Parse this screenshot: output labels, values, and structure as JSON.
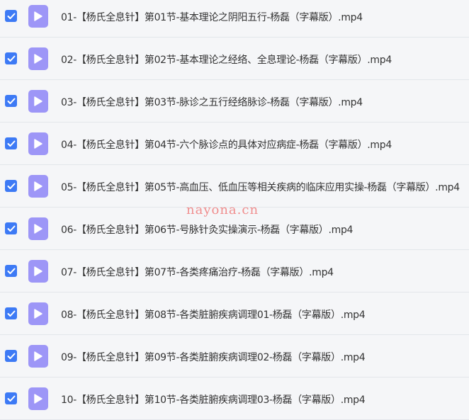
{
  "files": [
    {
      "name": "01-【杨氏全息针】第01节-基本理论之阴阳五行-杨磊（字幕版）.mp4",
      "checked": true,
      "icon": "video-file-icon"
    },
    {
      "name": "02-【杨氏全息针】第02节-基本理论之经络、全息理论-杨磊（字幕版）.mp4",
      "checked": true,
      "icon": "video-file-icon"
    },
    {
      "name": "03-【杨氏全息针】第03节-脉诊之五行经络脉诊-杨磊（字幕版）.mp4",
      "checked": true,
      "icon": "video-file-icon"
    },
    {
      "name": "04-【杨氏全息针】第04节-六个脉诊点的具体对应病症-杨磊（字幕版）.mp4",
      "checked": true,
      "icon": "video-file-icon"
    },
    {
      "name": "05-【杨氏全息针】第05节-高血压、低血压等相关疾病的临床应用实操-杨磊（字幕版）.mp4",
      "checked": true,
      "icon": "video-file-icon"
    },
    {
      "name": "06-【杨氏全息针】第06节-号脉针灸实操演示-杨磊（字幕版）.mp4",
      "checked": true,
      "icon": "video-file-icon"
    },
    {
      "name": "07-【杨氏全息针】第07节-各类疼痛治疗-杨磊（字幕版）.mp4",
      "checked": true,
      "icon": "video-file-icon"
    },
    {
      "name": "08-【杨氏全息针】第08节-各类脏腑疾病调理01-杨磊（字幕版）.mp4",
      "checked": true,
      "icon": "video-file-icon"
    },
    {
      "name": "09-【杨氏全息针】第09节-各类脏腑疾病调理02-杨磊（字幕版）.mp4",
      "checked": true,
      "icon": "video-file-icon"
    },
    {
      "name": "10-【杨氏全息针】第10节-各类脏腑疾病调理03-杨磊（字幕版）.mp4",
      "checked": true,
      "icon": "video-file-icon"
    }
  ],
  "watermark": "nayona.cn",
  "colors": {
    "checkbox": "#3d7af5",
    "file_icon": "#9d96f7",
    "background": "#f5f6f8"
  }
}
